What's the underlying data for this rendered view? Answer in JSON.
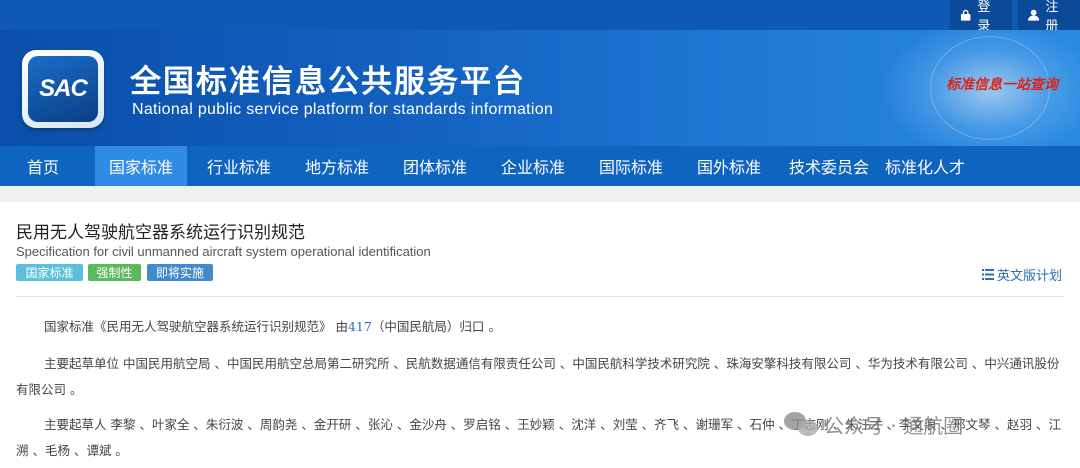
{
  "topbar": {
    "login_label": "登录",
    "register_label": "注册"
  },
  "banner": {
    "logo_text": "SAC",
    "title": "全国标准信息公共服务平台",
    "subtitle": "National public service platform  for standards information",
    "slogan": "标准信息一站查询"
  },
  "nav": {
    "items": [
      "首页",
      "国家标准",
      "行业标准",
      "地方标准",
      "团体标准",
      "企业标准",
      "国际标准",
      "国外标准",
      "技术委员会",
      "标准化人才"
    ],
    "active_index": 1
  },
  "document": {
    "title": "民用无人驾驶航空器系统运行识别规范",
    "title_en": "Specification for civil unmanned aircraft system operational identification",
    "tags": [
      "国家标准",
      "强制性",
      "即将实施"
    ],
    "en_plan_label": "英文版计划",
    "intro_prefix": "国家标准《民用无人驾驶航空器系统运行识别规范》 由",
    "intro_link": "417",
    "intro_suffix": "（中国民航局）归口 。",
    "drafting_units": "主要起草单位 中国民用航空局 、中国民用航空总局第二研究所 、民航数据通信有限责任公司 、中国民航科学技术研究院 、珠海安擎科技有限公司 、华为技术有限公司 、中兴通讯股份有限公司 。",
    "drafters": "主要起草人 李黎 、叶家全 、朱衍波 、周韵尧 、金开研 、张沁 、金沙舟 、罗启铭 、王妙颖 、沈洋 、刘莹 、齐飞 、谢珊军 、石仲 、丁志刚 、朱汪才 、李文浪 、邢文琴 、赵羽 、江溯 、毛杨 、谭斌 。"
  },
  "watermark": {
    "text": "公众号 · 通航圈"
  },
  "colors": {
    "nav_bg": "#0f64c0",
    "nav_active": "#2f8be4",
    "tag_national": "#5bc0de",
    "tag_mandatory": "#5cb85c",
    "tag_upcoming": "#428bca"
  }
}
